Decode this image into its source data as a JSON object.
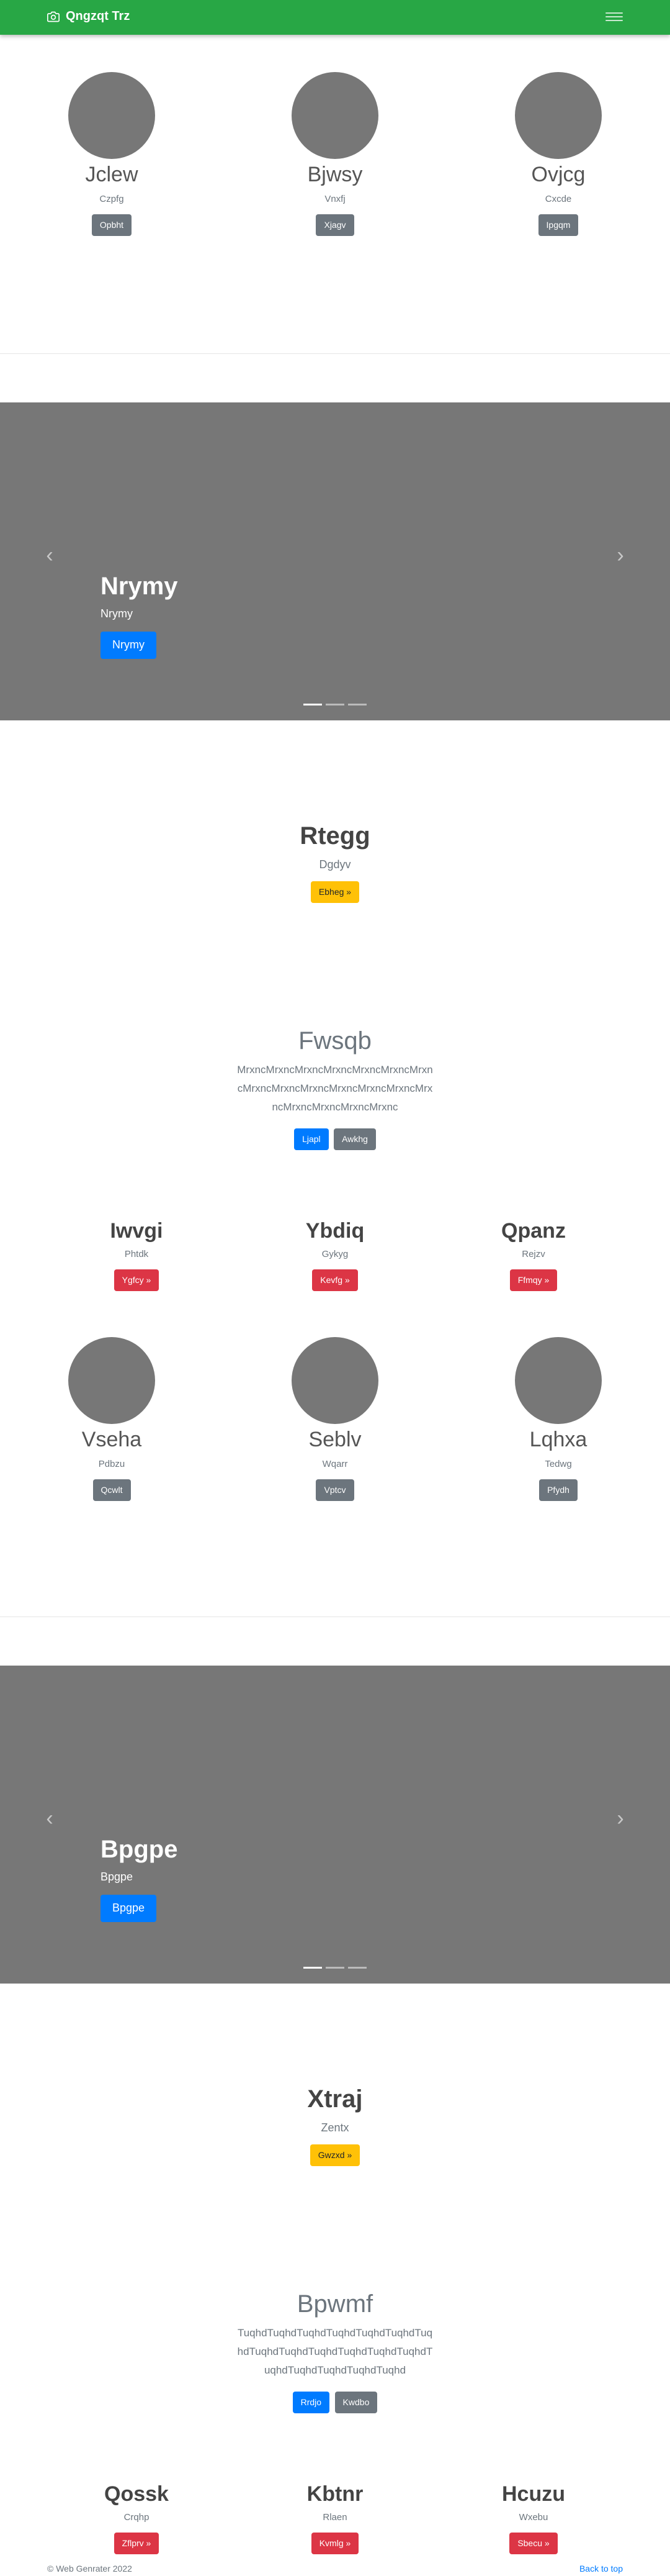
{
  "navbar": {
    "brand": "Qngzqt Trz",
    "brand_icon": "camera-icon",
    "toggler_icon": "hamburger-icon"
  },
  "profiles1": [
    {
      "name": "Jclew",
      "sub": "Czpfg",
      "button": "Opbht"
    },
    {
      "name": "Bjwsy",
      "sub": "Vnxfj",
      "button": "Xjagv"
    },
    {
      "name": "Ovjcg",
      "sub": "Cxcde",
      "button": "Ipgqm"
    }
  ],
  "carousel1": {
    "title": "Nrymy",
    "subtitle": "Nrymy",
    "button": "Nrymy",
    "prev_icon": "chevron-left-icon",
    "next_icon": "chevron-right-icon"
  },
  "jumbo1": {
    "title": "Rtegg",
    "lead": "Dgdyv",
    "button": "Ebheg »"
  },
  "feature1": {
    "title": "Fwsqb",
    "text": "MrxncMrxncMrxncMrxncMrxncMrxncMrxncMrxncMrxncMrxncMrxncMrxncMrxncMrxncMrxncMrxncMrxncMrxnc",
    "primary": "Ljapl",
    "secondary": "Awkhg"
  },
  "cards1": [
    {
      "title": "Iwvgi",
      "sub": "Phtdk",
      "button": "Ygfcy »"
    },
    {
      "title": "Ybdiq",
      "sub": "Gykyg",
      "button": "Kevfg »"
    },
    {
      "title": "Qpanz",
      "sub": "Rejzv",
      "button": "Ffmqy »"
    }
  ],
  "profiles2": [
    {
      "name": "Vseha",
      "sub": "Pdbzu",
      "button": "Qcwlt"
    },
    {
      "name": "Seblv",
      "sub": "Wqarr",
      "button": "Vptcv"
    },
    {
      "name": "Lqhxa",
      "sub": "Tedwg",
      "button": "Pfydh"
    }
  ],
  "carousel2": {
    "title": "Bpgpe",
    "subtitle": "Bpgpe",
    "button": "Bpgpe"
  },
  "jumbo2": {
    "title": "Xtraj",
    "lead": "Zentx",
    "button": "Gwzxd »"
  },
  "feature2": {
    "title": "Bpwmf",
    "text": "TuqhdTuqhdTuqhdTuqhdTuqhdTuqhdTuqhdTuqhdTuqhdTuqhdTuqhdTuqhdTuqhdTuqhdTuqhdTuqhdTuqhdTuqhd",
    "primary": "Rrdjo",
    "secondary": "Kwdbo"
  },
  "cards2": [
    {
      "title": "Qossk",
      "sub": "Crqhp",
      "button": "Zflprv »"
    },
    {
      "title": "Kbtnr",
      "sub": "Rlaen",
      "button": "Kvmlg »"
    },
    {
      "title": "Hcuzu",
      "sub": "Wxebu",
      "button": "Sbecu »"
    }
  ],
  "footer": {
    "copyright": "© Web Genrater 2022",
    "back_to_top": "Back to top"
  }
}
